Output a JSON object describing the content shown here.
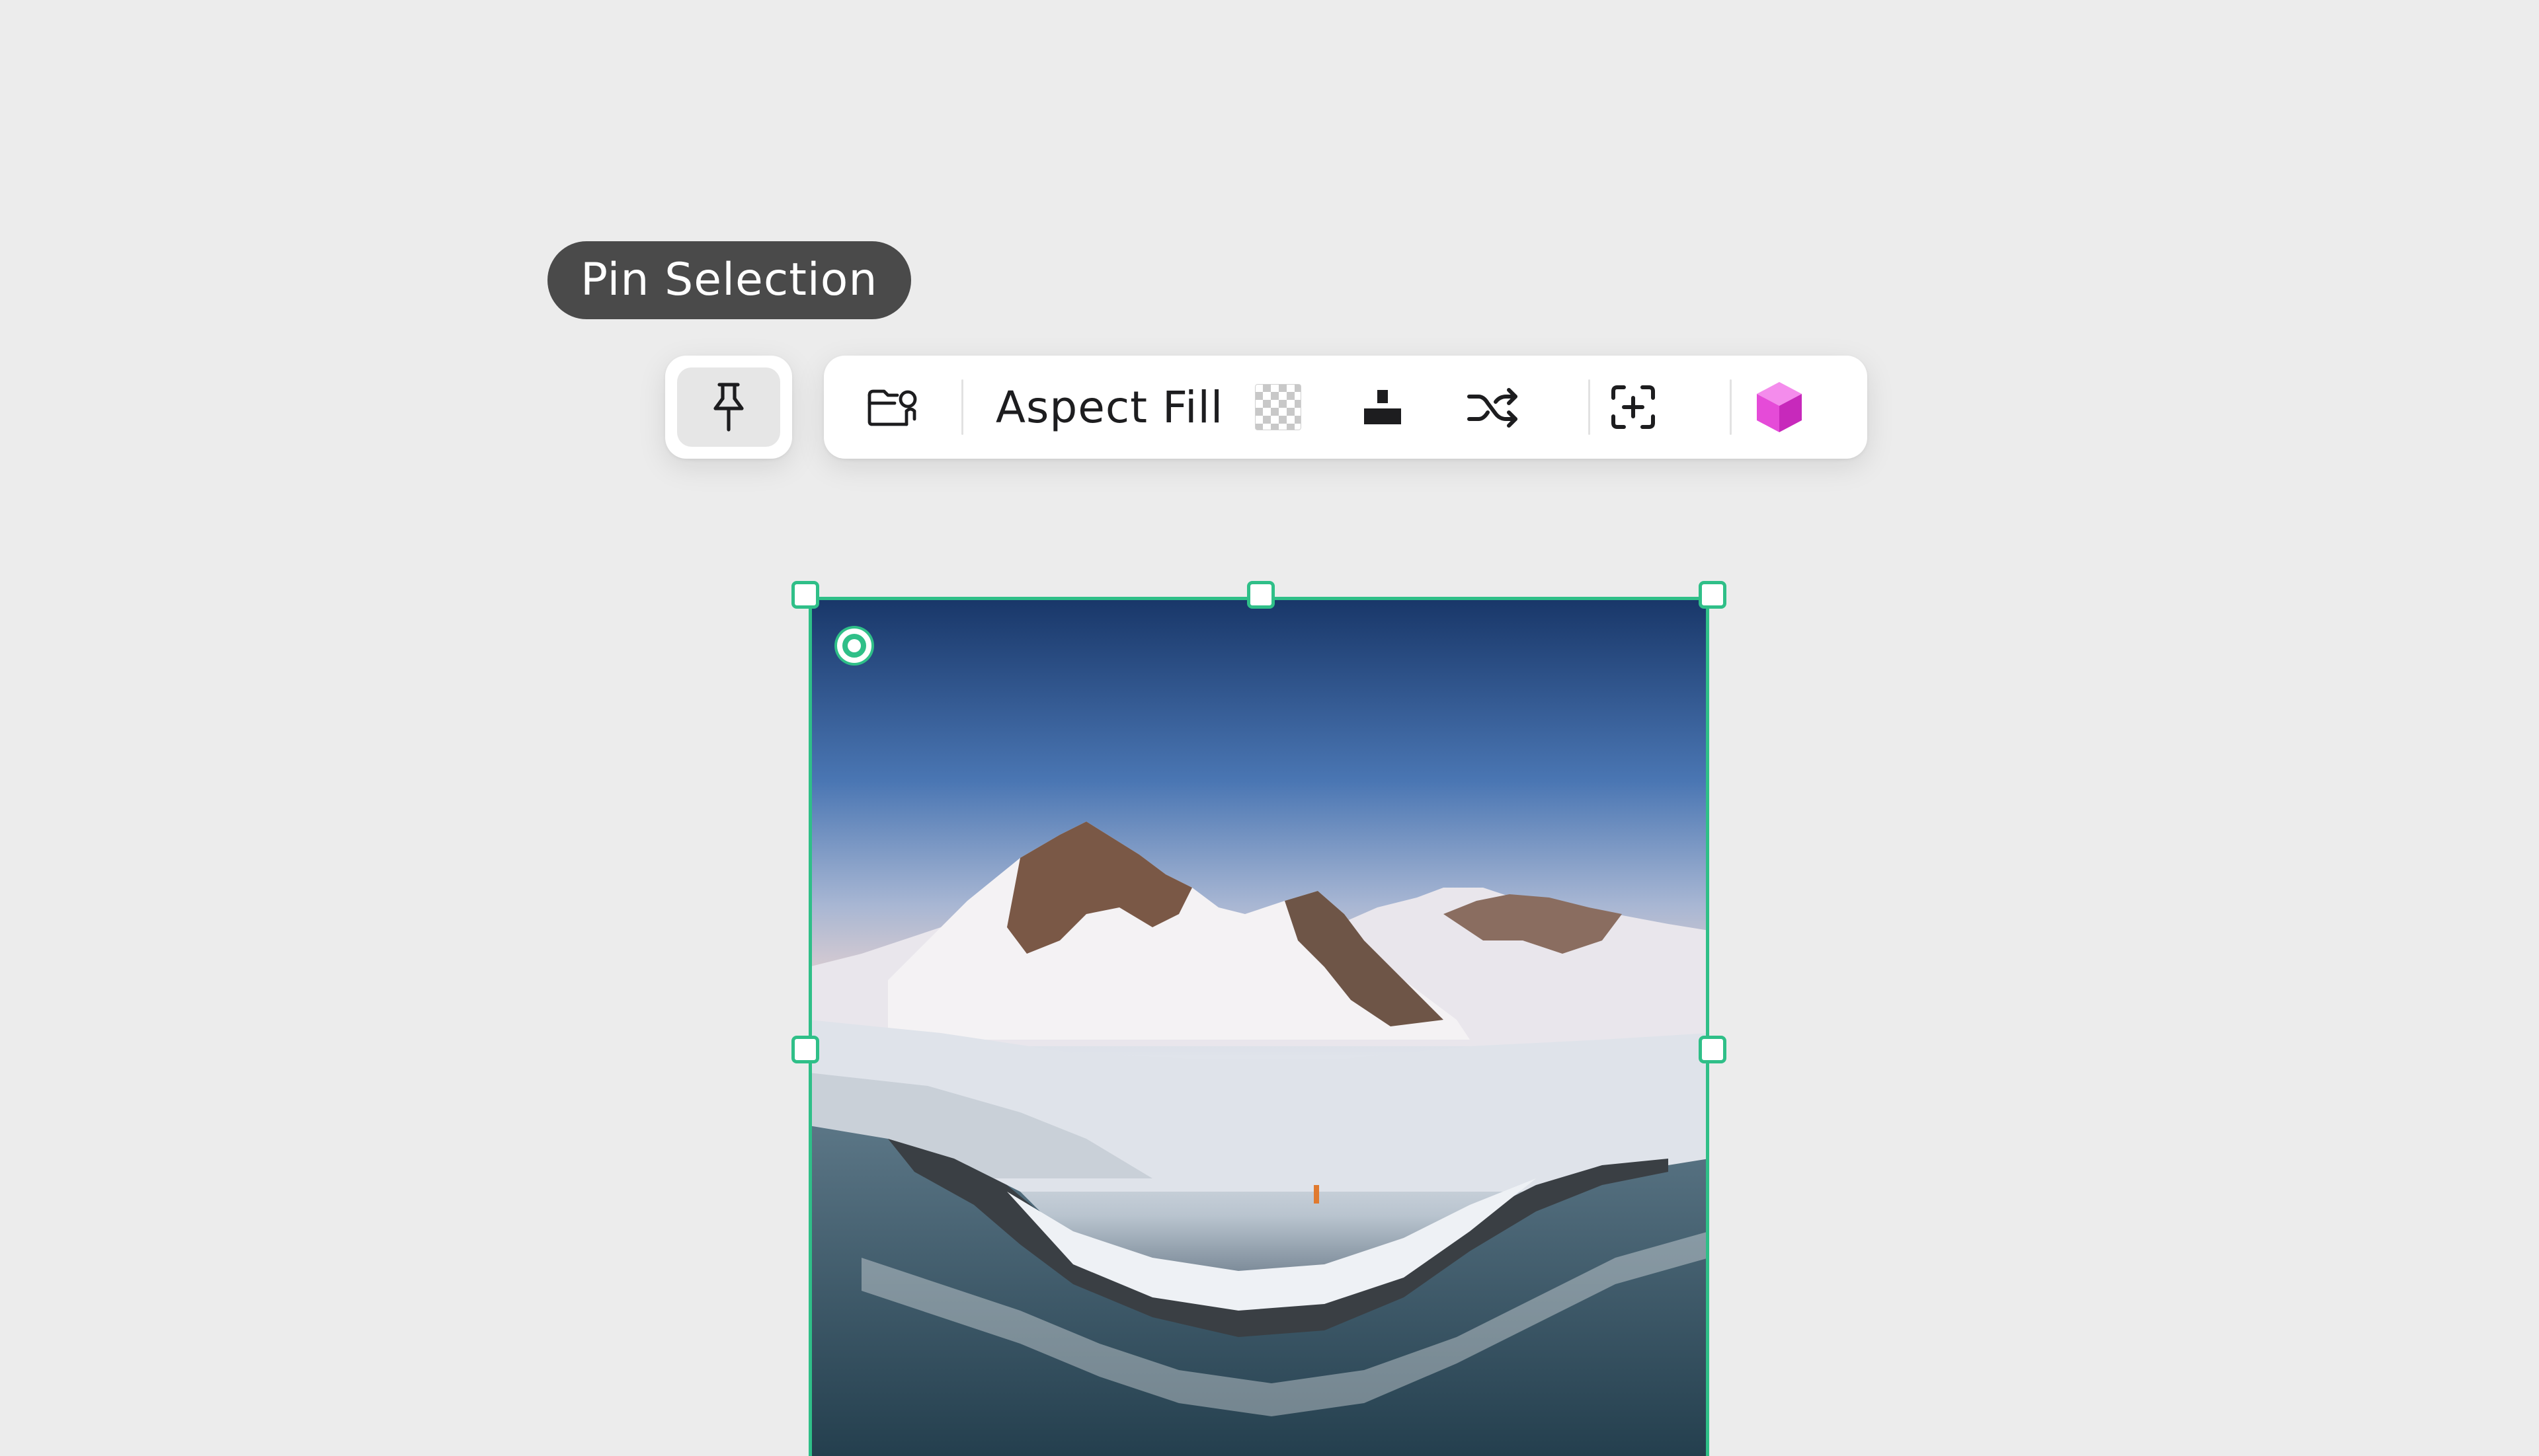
{
  "tooltip": {
    "text": "Pin Selection"
  },
  "toolbar": {
    "pin_icon": "pin-icon",
    "open_icon": "folder-image-icon",
    "fill_mode_label": "Aspect Fill",
    "transparency_icon": "checkerboard-icon",
    "stack_icon": "layer-stack-icon",
    "shuffle_icon": "shuffle-icon",
    "add_frame_icon": "add-frame-icon",
    "cube_icon": "cube-icon",
    "cube_color": "#e54bd8"
  },
  "selection": {
    "accent_color": "#2fbf88"
  }
}
